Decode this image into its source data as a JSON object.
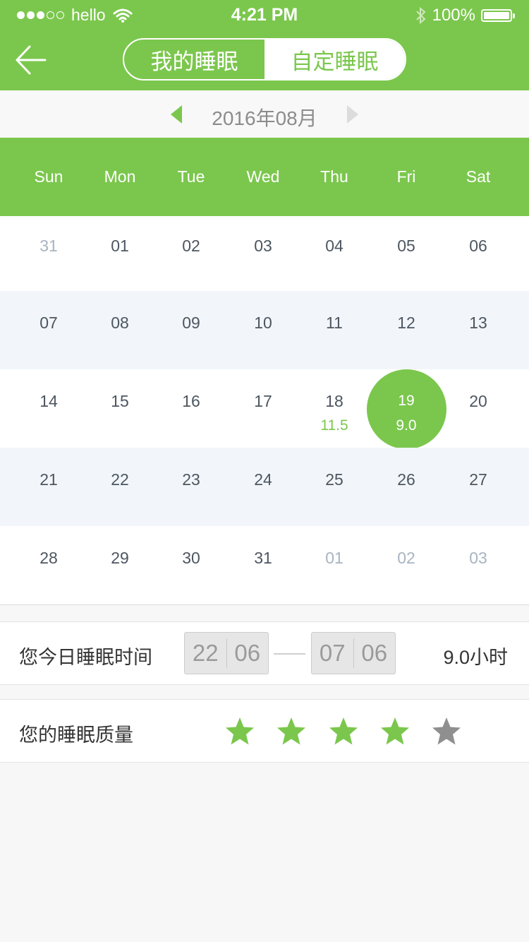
{
  "status_bar": {
    "carrier": "hello",
    "signal_filled": 3,
    "signal_total": 5,
    "time": "4:21 PM",
    "battery": "100%",
    "battery_level": 1.0
  },
  "header": {
    "tabs": [
      {
        "label": "我的睡眠",
        "active": false
      },
      {
        "label": "自定睡眠",
        "active": true
      }
    ]
  },
  "calendar": {
    "month_label": "2016年08月",
    "weekdays": [
      "Sun",
      "Mon",
      "Tue",
      "Wed",
      "Thu",
      "Fri",
      "Sat"
    ],
    "weeks": [
      [
        {
          "day": "31",
          "other": true
        },
        {
          "day": "01"
        },
        {
          "day": "02"
        },
        {
          "day": "03"
        },
        {
          "day": "04"
        },
        {
          "day": "05"
        },
        {
          "day": "06"
        }
      ],
      [
        {
          "day": "07"
        },
        {
          "day": "08"
        },
        {
          "day": "09"
        },
        {
          "day": "10"
        },
        {
          "day": "11"
        },
        {
          "day": "12"
        },
        {
          "day": "13"
        }
      ],
      [
        {
          "day": "14"
        },
        {
          "day": "15"
        },
        {
          "day": "16"
        },
        {
          "day": "17"
        },
        {
          "day": "18",
          "sub": "11.5"
        },
        {
          "day": "19",
          "sub": "9.0",
          "selected": true
        },
        {
          "day": "20"
        }
      ],
      [
        {
          "day": "21"
        },
        {
          "day": "22"
        },
        {
          "day": "23"
        },
        {
          "day": "24"
        },
        {
          "day": "25"
        },
        {
          "day": "26"
        },
        {
          "day": "27"
        }
      ],
      [
        {
          "day": "28"
        },
        {
          "day": "29"
        },
        {
          "day": "30"
        },
        {
          "day": "31"
        },
        {
          "day": "01",
          "other": true
        },
        {
          "day": "02",
          "other": true
        },
        {
          "day": "03",
          "other": true
        }
      ]
    ]
  },
  "sleep_time": {
    "label": "您今日睡眠时间",
    "start_hour": "22",
    "start_minute": "06",
    "end_hour": "07",
    "end_minute": "06",
    "total": "9.0小时"
  },
  "sleep_quality": {
    "label": "您的睡眠质量",
    "rating": 4,
    "max": 5
  },
  "colors": {
    "accent": "#7bc74d",
    "star_off": "#8f8f8f"
  }
}
